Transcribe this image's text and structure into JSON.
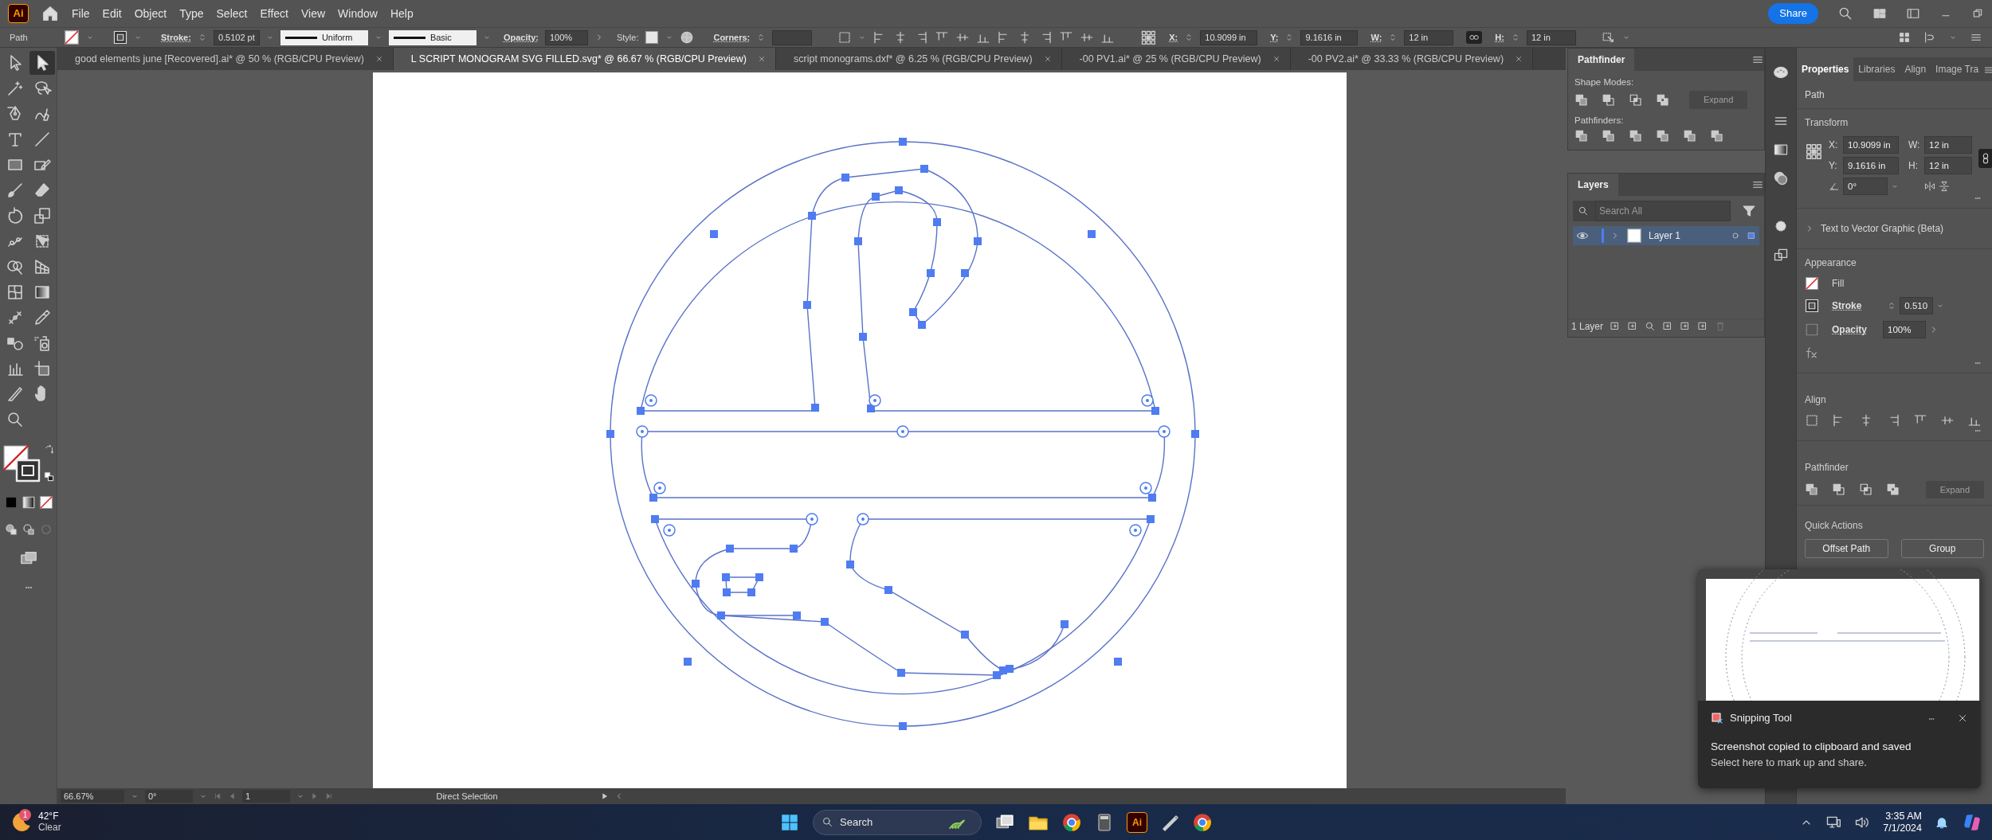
{
  "app_logo": "Ai",
  "menu": [
    "File",
    "Edit",
    "Object",
    "Type",
    "Select",
    "Effect",
    "View",
    "Window",
    "Help"
  ],
  "share": "Share",
  "control_bar": {
    "object_type": "Path",
    "stroke_label": "Stroke:",
    "stroke_weight": "0.5102 pt",
    "stroke_profile": "Uniform",
    "brush": "Basic",
    "opacity_label": "Opacity:",
    "opacity": "100%",
    "style_label": "Style:",
    "corners_label": "Corners:",
    "x_label": "X:",
    "x": "10.9099 in",
    "y_label": "Y:",
    "y": "9.1616 in",
    "w_label": "W:",
    "w": "12 in",
    "h_label": "H:",
    "h": "12 in",
    "constrain_linked": true
  },
  "document_tabs": [
    {
      "title": "good elements june [Recovered].ai* @ 50 % (RGB/CPU Preview)",
      "selected": false
    },
    {
      "title": "L SCRIPT MONOGRAM SVG FILLED.svg* @ 66.67 % (RGB/CPU Preview)",
      "selected": true
    },
    {
      "title": "script monograms.dxf* @ 6.25 % (RGB/CPU Preview)",
      "selected": false
    },
    {
      "title": "-00 PV1.ai* @ 25 % (RGB/CPU Preview)",
      "selected": false
    },
    {
      "title": "-00 PV2.ai* @ 33.33 % (RGB/CPU Preview)",
      "selected": false
    }
  ],
  "tools": [
    {
      "selected": false
    },
    {
      "selected": true
    },
    {
      "selected": false
    },
    {
      "selected": false
    },
    {
      "selected": false
    },
    {
      "selected": false
    },
    {
      "selected": false
    },
    {
      "selected": false
    },
    {
      "selected": false
    },
    {
      "selected": false
    },
    {
      "selected": false
    },
    {
      "selected": false
    },
    {
      "selected": false
    },
    {
      "selected": false
    },
    {
      "selected": false
    },
    {
      "selected": false
    },
    {
      "selected": false
    },
    {
      "selected": false
    },
    {
      "selected": false
    },
    {
      "selected": false
    },
    {
      "selected": false
    },
    {
      "selected": false
    },
    {
      "selected": false
    },
    {
      "selected": false
    },
    {
      "selected": false
    },
    {
      "selected": false
    },
    {
      "selected": false
    },
    {
      "selected": false
    },
    {
      "selected": false
    }
  ],
  "status_bar": {
    "zoom": "66.67%",
    "rotation": "0°",
    "artboard": "1",
    "current_tool": "Direct Selection"
  },
  "pathfinder_panel": {
    "title": "Pathfinder",
    "shape_modes_label": "Shape Modes:",
    "expand": "Expand",
    "expand_disabled": true,
    "pathfinders_label": "Pathfinders:"
  },
  "layers_panel": {
    "title": "Layers",
    "search_placeholder": "Search All",
    "layers": [
      {
        "name": "Layer 1",
        "visible": true,
        "selected": true
      }
    ],
    "count": "1 Layer"
  },
  "properties_panel": {
    "tabs": [
      {
        "label": "Properties",
        "selected": true
      },
      {
        "label": "Libraries",
        "selected": false
      },
      {
        "label": "Align",
        "selected": false
      },
      {
        "label": "Image Tra",
        "selected": false
      }
    ],
    "object_type": "Path",
    "transform_title": "Transform",
    "x_label": "X:",
    "x": "10.9099 in",
    "y_label": "Y:",
    "y": "9.1616 in",
    "w_label": "W:",
    "w": "12 in",
    "h_label": "H:",
    "h": "12 in",
    "constrain_linked": true,
    "angle": "0°",
    "text_to_vector": "Text to Vector Graphic (Beta)",
    "appearance_title": "Appearance",
    "fill_label": "Fill",
    "stroke_label": "Stroke",
    "stroke_weight": "0.510",
    "opacity_label": "Opacity",
    "opacity": "100%",
    "align_title": "Align",
    "pathfinder_title": "Pathfinder",
    "expand": "Expand",
    "expand_disabled": true,
    "quick_actions_title": "Quick Actions",
    "quick_actions": [
      "Offset Path",
      "Group"
    ]
  },
  "notification": {
    "app": "Snipping Tool",
    "title": "Screenshot copied to clipboard and saved",
    "body": "Select here to mark up and share."
  },
  "taskbar": {
    "weather_badge": "1",
    "temperature": "42°F",
    "condition": "Clear",
    "search": "Search",
    "illustrator_label": "Ai",
    "time": "3:35 AM",
    "date": "7/1/2024"
  }
}
